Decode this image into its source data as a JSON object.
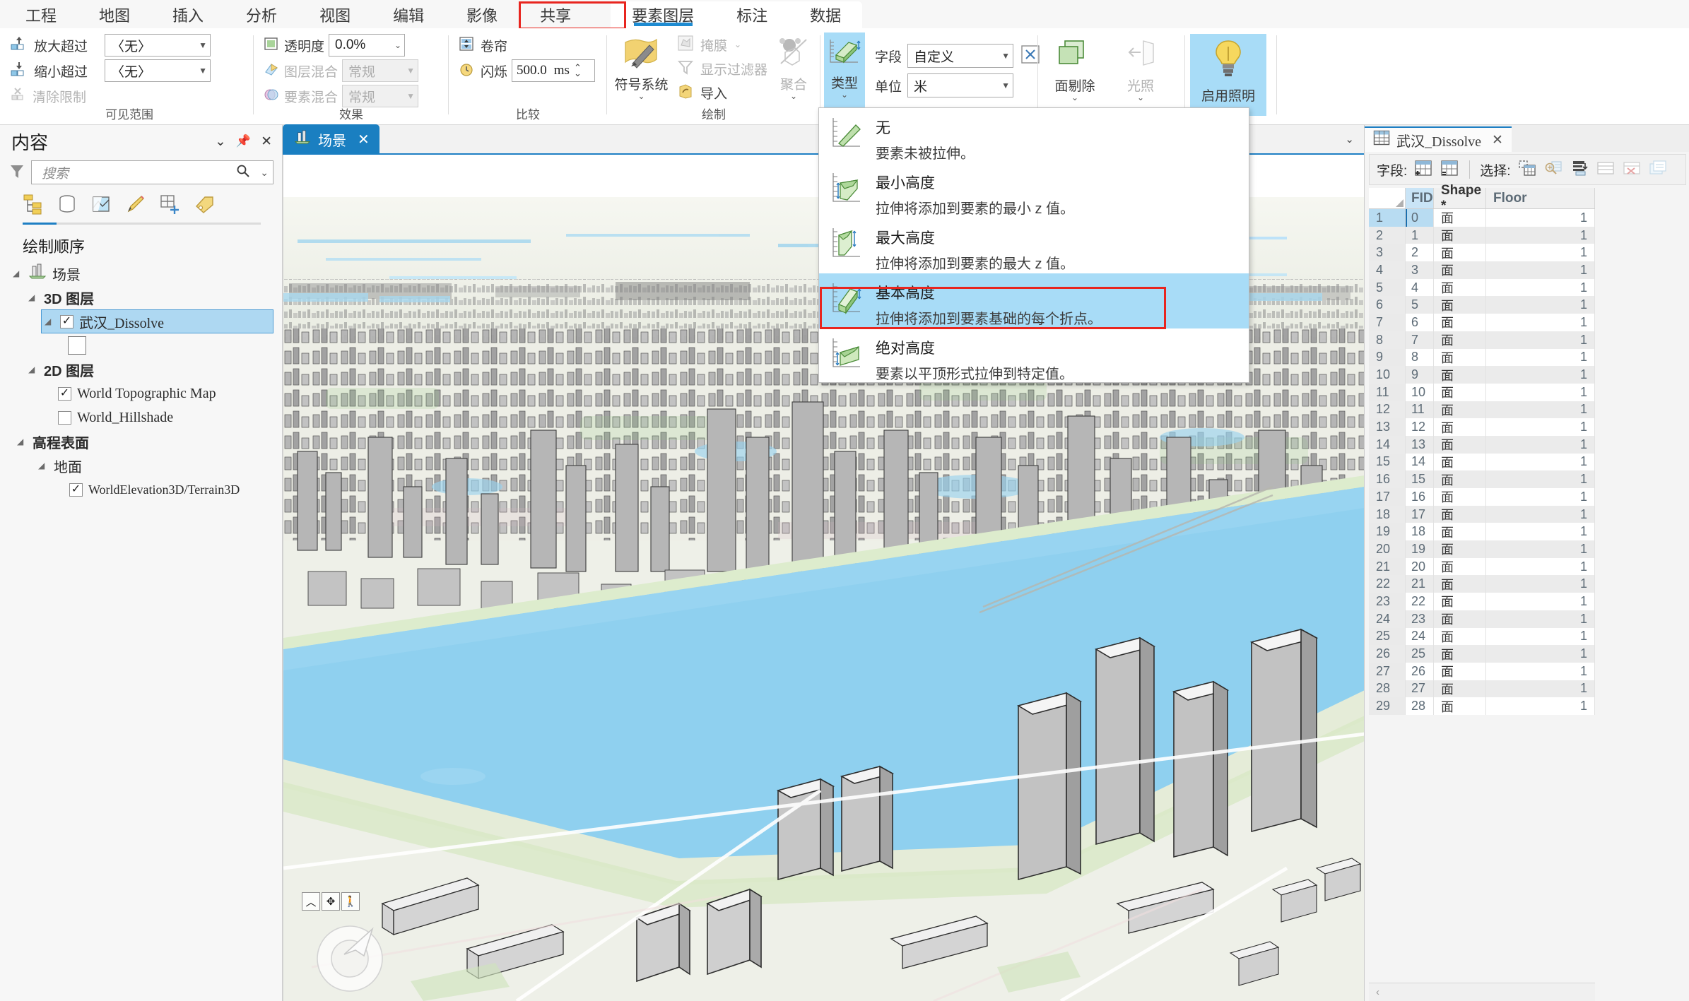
{
  "ribbon": {
    "tabs": [
      {
        "label": "工程",
        "type": "normal"
      },
      {
        "label": "地图",
        "type": "normal"
      },
      {
        "label": "插入",
        "type": "normal"
      },
      {
        "label": "分析",
        "type": "normal"
      },
      {
        "label": "视图",
        "type": "normal"
      },
      {
        "label": "编辑",
        "type": "normal"
      },
      {
        "label": "影像",
        "type": "normal"
      },
      {
        "label": "共享",
        "type": "normal"
      }
    ],
    "context_tabs": [
      {
        "label": "要素图层",
        "active": true
      },
      {
        "label": "标注",
        "active": false
      },
      {
        "label": "数据",
        "active": false
      }
    ],
    "groups": {
      "visible_range": {
        "label": "可见范围",
        "zoom_in_label": "放大超过",
        "zoom_in_value": "〈无〉",
        "zoom_out_label": "缩小超过",
        "zoom_out_value": "〈无〉",
        "clear_limits_label": "清除限制"
      },
      "effects": {
        "label": "效果",
        "transparency_label": "透明度",
        "transparency_value": "0.0%",
        "layer_blend_label": "图层混合",
        "layer_blend_value": "常规",
        "feature_blend_label": "要素混合",
        "feature_blend_value": "常规"
      },
      "compare": {
        "label": "比较",
        "swipe_label": "卷帘",
        "flash_label": "闪烁",
        "flash_value": "500.0",
        "flash_unit": "ms"
      },
      "drawing": {
        "label": "绘制",
        "symbology_label": "符号系统",
        "mask_label": "掩膜",
        "display_filter_label": "显示过滤器",
        "import_label": "导入",
        "aggregate_label": "聚合"
      },
      "extrusion": {
        "type_label": "类型",
        "field_label": "字段",
        "field_value": "自定义",
        "unit_label": "单位",
        "unit_value": "米",
        "expression_button": "X",
        "face_cull_label": "面剔除",
        "lighting_label": "光照",
        "enable_lighting_label": "启用照明"
      }
    }
  },
  "extrusion_menu": {
    "items": [
      {
        "title": "无",
        "desc": "要素未被拉伸。",
        "icon": "extrusion-none-icon",
        "highlighted": false
      },
      {
        "title": "最小高度",
        "desc": "拉伸将添加到要素的最小 z 值。",
        "icon": "extrusion-min-height-icon",
        "highlighted": false
      },
      {
        "title": "最大高度",
        "desc": "拉伸将添加到要素的最大 z 值。",
        "icon": "extrusion-max-height-icon",
        "highlighted": false
      },
      {
        "title": "基本高度",
        "desc": "拉伸将添加到要素基础的每个折点。",
        "icon": "extrusion-base-height-icon",
        "highlighted": true
      },
      {
        "title": "绝对高度",
        "desc": "要素以平顶形式拉伸到特定值。",
        "icon": "extrusion-absolute-height-icon",
        "highlighted": false
      }
    ]
  },
  "contents": {
    "title": "内容",
    "search_placeholder": "搜索",
    "collapse_icon": "chevron-down-icon",
    "pin_icon": "pin-icon",
    "close_icon": "close-icon",
    "filter_icon": "filter-icon",
    "search_icon": "search-icon",
    "list_tabs": [
      "drawing-order-icon",
      "data-source-icon",
      "selection-icon",
      "editing-icon",
      "snapping-icon",
      "labeling-icon"
    ],
    "draw_order_label": "绘制顺序",
    "tree": [
      {
        "label": "场景",
        "level": 0,
        "icon": "scene-icon",
        "checkbox": "none",
        "expanded": true,
        "selected": false
      },
      {
        "label": "3D 图层",
        "level": 1,
        "icon": "none",
        "checkbox": "none",
        "expanded": true,
        "selected": false
      },
      {
        "label": "武汉_Dissolve",
        "level": 2,
        "icon": "none",
        "checkbox": "checked",
        "expanded": true,
        "selected": true,
        "mono": true
      },
      {
        "label": "",
        "level": 3,
        "icon": "symbol-swatch",
        "checkbox": "none",
        "expanded": false,
        "selected": false
      },
      {
        "label": "2D 图层",
        "level": 1,
        "icon": "none",
        "checkbox": "none",
        "expanded": true,
        "selected": false
      },
      {
        "label": "World Topographic Map",
        "level": 2,
        "icon": "none",
        "checkbox": "checked",
        "expanded": false,
        "selected": false,
        "mono": true
      },
      {
        "label": "World_Hillshade",
        "level": 2,
        "icon": "none",
        "checkbox": "unchecked",
        "expanded": false,
        "selected": false,
        "mono": true
      },
      {
        "label": "高程表面",
        "level": 1,
        "icon": "none",
        "checkbox": "none",
        "expanded": true,
        "selected": false
      },
      {
        "label": "地面",
        "level": 2,
        "icon": "none",
        "checkbox": "none",
        "expanded": true,
        "selected": false
      },
      {
        "label": "WorldElevation3D/Terrain3D",
        "level": 3,
        "icon": "none",
        "checkbox": "checked",
        "expanded": false,
        "selected": false,
        "mono": true
      }
    ]
  },
  "view": {
    "tab_label": "场景",
    "tab_icon": "scene-icon",
    "close_icon": "close-icon",
    "overflow_icon": "chevron-down-icon",
    "nav_buttons": [
      "up-arrow-icon",
      "pan-icon",
      "walk-icon"
    ],
    "nav_wheel_icon": "navigation-wheel-icon"
  },
  "table": {
    "tab_label": "武汉_Dissolve",
    "tab_icon": "table-icon",
    "close_icon": "close-icon",
    "toolbar": {
      "fields_label": "字段:",
      "fields_icons": [
        "add-field-icon",
        "calculate-field-icon"
      ],
      "select_label": "选择:",
      "select_icons": [
        "select-by-attributes-icon",
        "zoom-to-selection-icon",
        "switch-selection-icon",
        "select-all-icon",
        "clear-selection-icon",
        "delete-selection-icon"
      ]
    },
    "columns": [
      "",
      "FID",
      "Shape *",
      "Floor"
    ],
    "rows": [
      {
        "n": "1",
        "fid": "0",
        "shape": "面",
        "floor": "1"
      },
      {
        "n": "2",
        "fid": "1",
        "shape": "面",
        "floor": "1"
      },
      {
        "n": "3",
        "fid": "2",
        "shape": "面",
        "floor": "1"
      },
      {
        "n": "4",
        "fid": "3",
        "shape": "面",
        "floor": "1"
      },
      {
        "n": "5",
        "fid": "4",
        "shape": "面",
        "floor": "1"
      },
      {
        "n": "6",
        "fid": "5",
        "shape": "面",
        "floor": "1"
      },
      {
        "n": "7",
        "fid": "6",
        "shape": "面",
        "floor": "1"
      },
      {
        "n": "8",
        "fid": "7",
        "shape": "面",
        "floor": "1"
      },
      {
        "n": "9",
        "fid": "8",
        "shape": "面",
        "floor": "1"
      },
      {
        "n": "10",
        "fid": "9",
        "shape": "面",
        "floor": "1"
      },
      {
        "n": "11",
        "fid": "10",
        "shape": "面",
        "floor": "1"
      },
      {
        "n": "12",
        "fid": "11",
        "shape": "面",
        "floor": "1"
      },
      {
        "n": "13",
        "fid": "12",
        "shape": "面",
        "floor": "1"
      },
      {
        "n": "14",
        "fid": "13",
        "shape": "面",
        "floor": "1"
      },
      {
        "n": "15",
        "fid": "14",
        "shape": "面",
        "floor": "1"
      },
      {
        "n": "16",
        "fid": "15",
        "shape": "面",
        "floor": "1"
      },
      {
        "n": "17",
        "fid": "16",
        "shape": "面",
        "floor": "1"
      },
      {
        "n": "18",
        "fid": "17",
        "shape": "面",
        "floor": "1"
      },
      {
        "n": "19",
        "fid": "18",
        "shape": "面",
        "floor": "1"
      },
      {
        "n": "20",
        "fid": "19",
        "shape": "面",
        "floor": "1"
      },
      {
        "n": "21",
        "fid": "20",
        "shape": "面",
        "floor": "1"
      },
      {
        "n": "22",
        "fid": "21",
        "shape": "面",
        "floor": "1"
      },
      {
        "n": "23",
        "fid": "22",
        "shape": "面",
        "floor": "1"
      },
      {
        "n": "24",
        "fid": "23",
        "shape": "面",
        "floor": "1"
      },
      {
        "n": "25",
        "fid": "24",
        "shape": "面",
        "floor": "1"
      },
      {
        "n": "26",
        "fid": "25",
        "shape": "面",
        "floor": "1"
      },
      {
        "n": "27",
        "fid": "26",
        "shape": "面",
        "floor": "1"
      },
      {
        "n": "28",
        "fid": "27",
        "shape": "面",
        "floor": "1"
      },
      {
        "n": "29",
        "fid": "28",
        "shape": "面",
        "floor": "1"
      }
    ],
    "selected_row_index": 0
  },
  "colors": {
    "accent": "#1e7fc4",
    "highlight_red": "#e8251f",
    "selection_blue": "#a8dcf7",
    "ribbon_bg": "#ffffff",
    "panel_bg": "#f7f7f7",
    "water": "#8fd0ef",
    "building": "#b9b9b9"
  }
}
